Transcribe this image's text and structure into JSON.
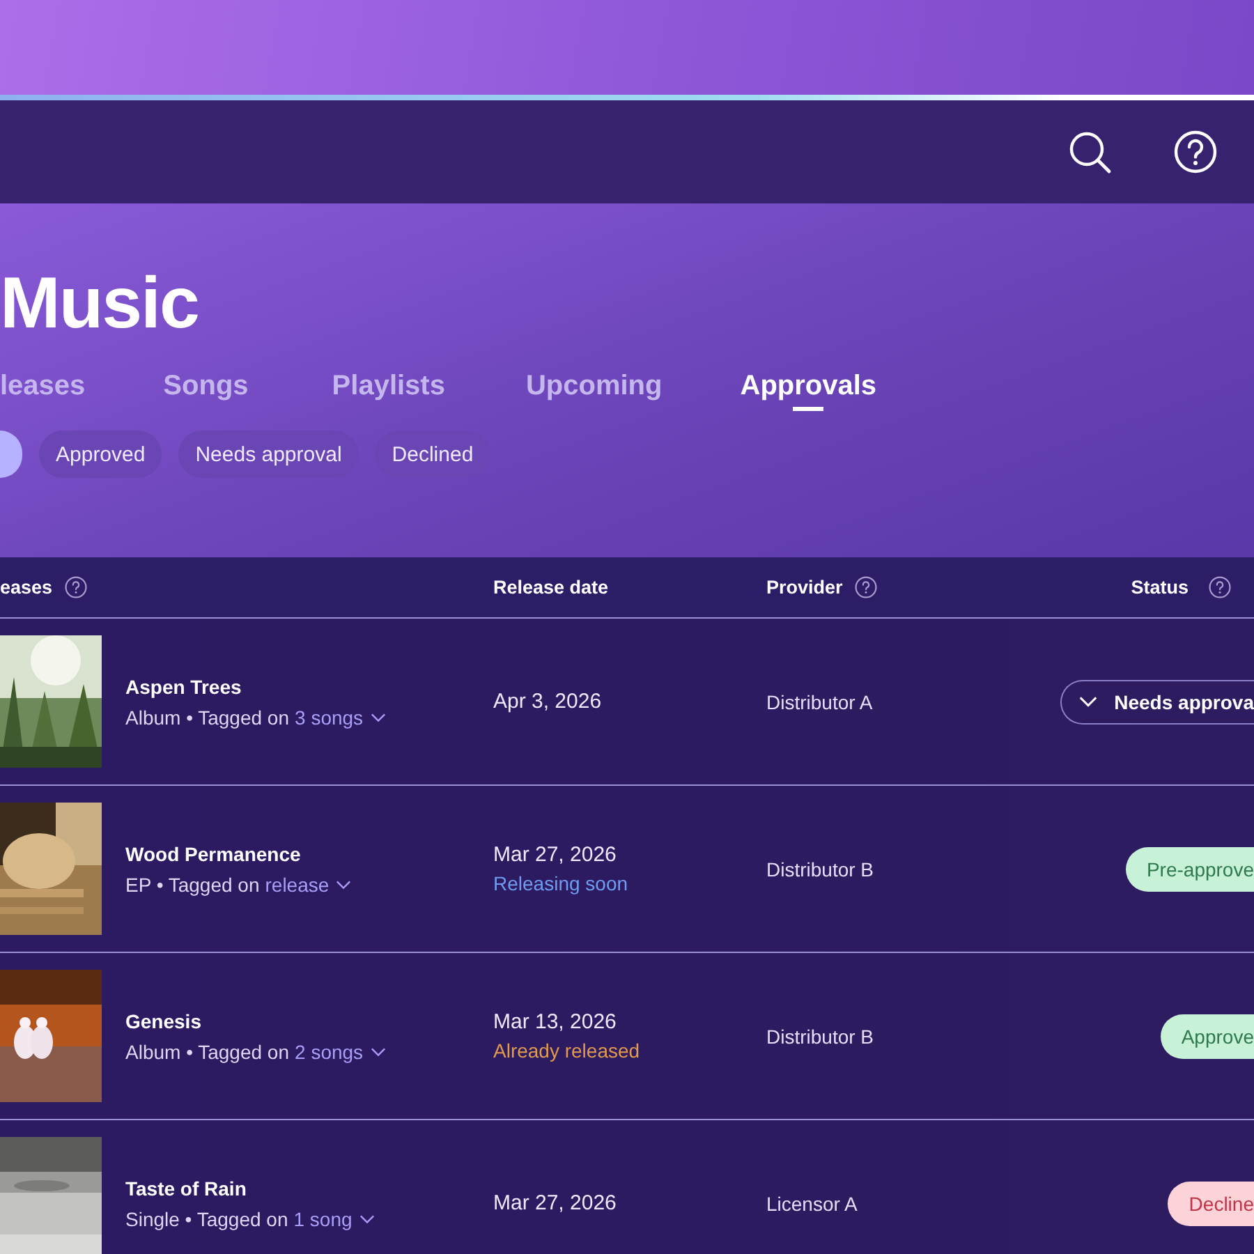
{
  "page_title": "Music",
  "tabs": [
    {
      "label": "leases",
      "selected": false
    },
    {
      "label": "Songs",
      "selected": false
    },
    {
      "label": "Playlists",
      "selected": false
    },
    {
      "label": "Upcoming",
      "selected": false
    },
    {
      "label": "Approvals",
      "selected": true
    }
  ],
  "filters": [
    {
      "selected": true
    },
    {
      "label": "Approved",
      "selected": false
    },
    {
      "label": "Needs approval",
      "selected": false
    },
    {
      "label": "Declined",
      "selected": false
    }
  ],
  "table": {
    "columns": [
      {
        "label": "eases",
        "help": true
      },
      {
        "label": "Release date",
        "help": false
      },
      {
        "label": "Provider",
        "help": true
      },
      {
        "label": "Status",
        "help": true
      }
    ],
    "rows": [
      {
        "title": "Aspen Trees",
        "meta": "Album • Tagged on",
        "link": "3 songs",
        "date": "Apr 3, 2026",
        "provider": "Distributor A",
        "status": {
          "label": "Needs approva",
          "kind": "needs"
        }
      },
      {
        "title": "Wood Permanence",
        "meta": "EP • Tagged on",
        "link": "release",
        "date": "Mar 27, 2026",
        "note": {
          "text": "Releasing soon",
          "kind": "upcoming"
        },
        "provider": "Distributor B",
        "status": {
          "label": "Pre-approve",
          "kind": "approved"
        }
      },
      {
        "title": "Genesis",
        "meta": "Album • Tagged on",
        "link": "2 songs",
        "date": "Mar 13, 2026",
        "note": {
          "text": "Already released",
          "kind": "released"
        },
        "provider": "Distributor B",
        "status": {
          "label": "Approve",
          "kind": "approved"
        }
      },
      {
        "title": "Taste of Rain",
        "meta": "Single • Tagged on",
        "link": "1 song",
        "date": "Mar 27, 2026",
        "provider": "Licensor A",
        "status": {
          "label": "Decline",
          "kind": "declined"
        }
      }
    ]
  }
}
